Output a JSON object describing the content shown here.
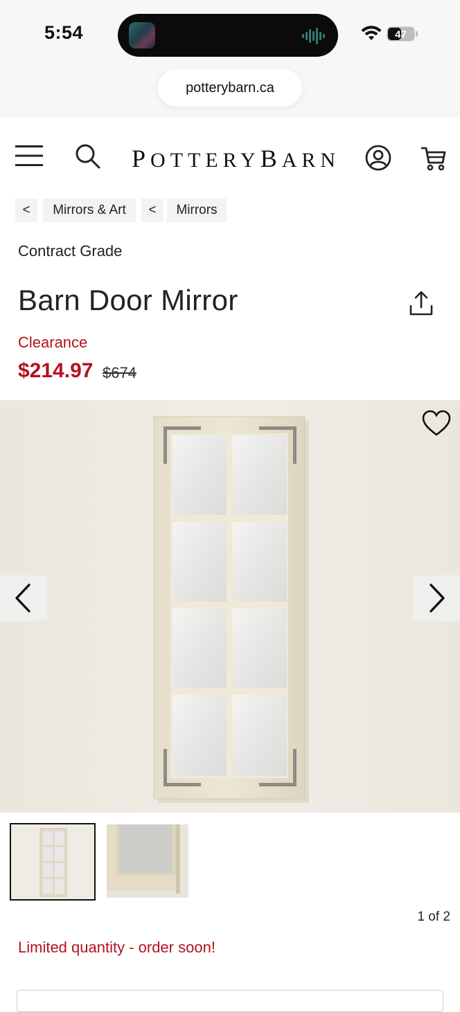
{
  "status_bar": {
    "time": "5:54",
    "battery": "47",
    "icons": [
      "now-playing-thumbnail",
      "audio-wave-icon",
      "wifi-icon",
      "battery-icon"
    ]
  },
  "browser": {
    "url": "potterybarn.ca"
  },
  "header": {
    "logo_first": "P",
    "logo_rest1": "OTTERY",
    "logo_second": "B",
    "logo_rest2": "ARN",
    "icons": [
      "menu-icon",
      "search-icon",
      "account-icon",
      "cart-icon"
    ]
  },
  "breadcrumb": [
    {
      "back": "<",
      "label": "Mirrors & Art"
    },
    {
      "back": "<",
      "label": "Mirrors"
    }
  ],
  "product": {
    "badge": "Contract Grade",
    "title": "Barn Door Mirror",
    "sale_label": "Clearance",
    "price": "$214.97",
    "original_price": "$674",
    "availability": "Limited quantity - order soon!"
  },
  "gallery": {
    "counter": "1 of 2",
    "current": 1,
    "total": 2
  },
  "colors": {
    "sale_red": "#b3121f",
    "text": "#222222",
    "crumb_bg": "#f3f3f3"
  }
}
